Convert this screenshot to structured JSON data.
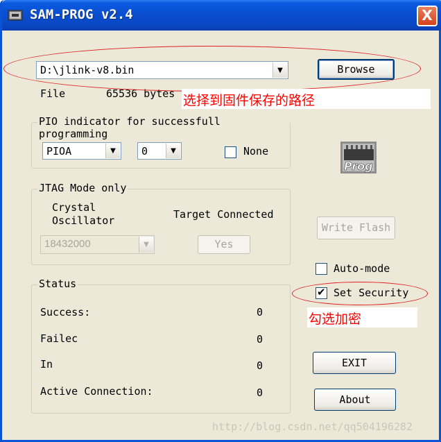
{
  "window": {
    "title": "SAM-PROG v2.4",
    "close_glyph": "X"
  },
  "file": {
    "path": "D:\\jlink-v8.bin",
    "browse_label": "Browse",
    "label": "File",
    "size": "65536 bytes"
  },
  "annotations": {
    "choose_path": "选择到固件保存的路径",
    "check_secure": "勾选加密"
  },
  "pio": {
    "legend": "PIO indicator for successfull programming",
    "port": "PIOA",
    "pin": "0",
    "none_label": "None",
    "none_checked": false
  },
  "jtag": {
    "legend": "JTAG Mode only",
    "crystal_line1": "Crystal",
    "crystal_line2": "Oscillator",
    "crystal_value": "18432000",
    "target_label": "Target Connected",
    "target_button": "Yes"
  },
  "actions": {
    "write_flash": "Write Flash",
    "auto_mode": "Auto-mode",
    "auto_mode_checked": false,
    "set_security": "Set Security",
    "set_security_checked": true,
    "exit": "EXIT",
    "about": "About"
  },
  "status": {
    "legend": "Status",
    "rows": [
      {
        "label": "Success:",
        "value": "0"
      },
      {
        "label": "Failec",
        "value": "0"
      },
      {
        "label": "In",
        "value": "0"
      },
      {
        "label": "Active Connection:",
        "value": "0"
      }
    ]
  },
  "prog_icon_text": "Prog",
  "watermark": "http://blog.csdn.net/qq504196282",
  "colors": {
    "annotation": "#ff0000",
    "title_bar": "#0a4fd0",
    "dialog_bg": "#ece9d8"
  }
}
